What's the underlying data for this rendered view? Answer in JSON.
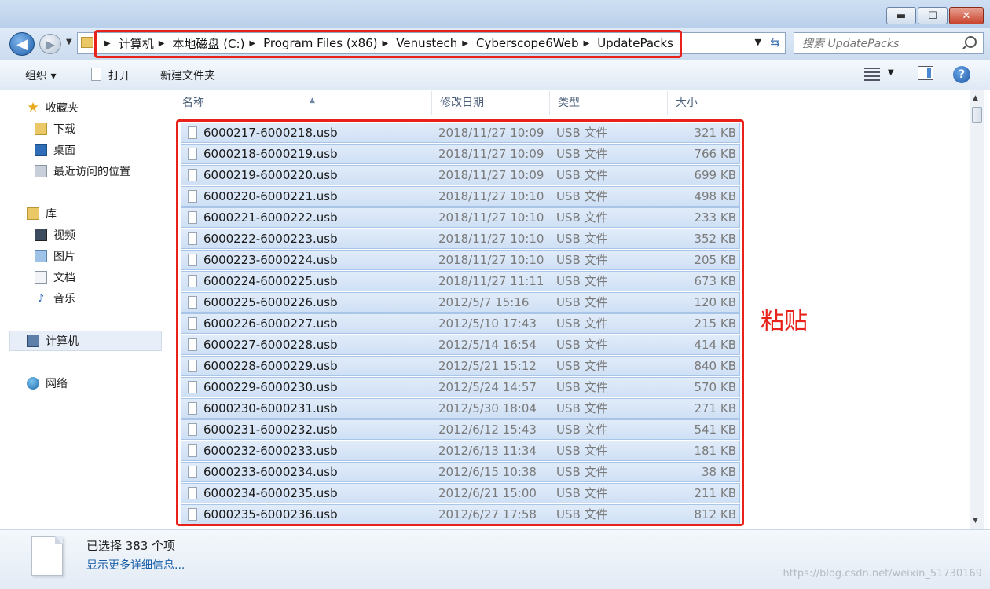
{
  "address": {
    "crumbs": [
      "计算机",
      "本地磁盘 (C:)",
      "Program Files (x86)",
      "Venustech",
      "Cyberscope6Web",
      "UpdatePacks"
    ]
  },
  "search": {
    "placeholder": "搜索 UpdatePacks"
  },
  "toolbar": {
    "organize": "组织 ▾",
    "open": "打开",
    "new_folder": "新建文件夹"
  },
  "sidebar": {
    "favorites": {
      "label": "收藏夹",
      "items": [
        "下载",
        "桌面",
        "最近访问的位置"
      ]
    },
    "libraries": {
      "label": "库",
      "items": [
        "视频",
        "图片",
        "文档",
        "音乐"
      ]
    },
    "computer": "计算机",
    "network": "网络"
  },
  "columns": {
    "name": "名称",
    "date": "修改日期",
    "type": "类型",
    "size": "大小"
  },
  "files": [
    {
      "name": "6000217-6000218.usb",
      "date": "2018/11/27 10:09",
      "type": "USB 文件",
      "size": "321 KB"
    },
    {
      "name": "6000218-6000219.usb",
      "date": "2018/11/27 10:09",
      "type": "USB 文件",
      "size": "766 KB"
    },
    {
      "name": "6000219-6000220.usb",
      "date": "2018/11/27 10:09",
      "type": "USB 文件",
      "size": "699 KB"
    },
    {
      "name": "6000220-6000221.usb",
      "date": "2018/11/27 10:10",
      "type": "USB 文件",
      "size": "498 KB"
    },
    {
      "name": "6000221-6000222.usb",
      "date": "2018/11/27 10:10",
      "type": "USB 文件",
      "size": "233 KB"
    },
    {
      "name": "6000222-6000223.usb",
      "date": "2018/11/27 10:10",
      "type": "USB 文件",
      "size": "352 KB"
    },
    {
      "name": "6000223-6000224.usb",
      "date": "2018/11/27 10:10",
      "type": "USB 文件",
      "size": "205 KB"
    },
    {
      "name": "6000224-6000225.usb",
      "date": "2018/11/27 11:11",
      "type": "USB 文件",
      "size": "673 KB"
    },
    {
      "name": "6000225-6000226.usb",
      "date": "2012/5/7 15:16",
      "type": "USB 文件",
      "size": "120 KB"
    },
    {
      "name": "6000226-6000227.usb",
      "date": "2012/5/10 17:43",
      "type": "USB 文件",
      "size": "215 KB"
    },
    {
      "name": "6000227-6000228.usb",
      "date": "2012/5/14 16:54",
      "type": "USB 文件",
      "size": "414 KB"
    },
    {
      "name": "6000228-6000229.usb",
      "date": "2012/5/21 15:12",
      "type": "USB 文件",
      "size": "840 KB"
    },
    {
      "name": "6000229-6000230.usb",
      "date": "2012/5/24 14:57",
      "type": "USB 文件",
      "size": "570 KB"
    },
    {
      "name": "6000230-6000231.usb",
      "date": "2012/5/30 18:04",
      "type": "USB 文件",
      "size": "271 KB"
    },
    {
      "name": "6000231-6000232.usb",
      "date": "2012/6/12 15:43",
      "type": "USB 文件",
      "size": "541 KB"
    },
    {
      "name": "6000232-6000233.usb",
      "date": "2012/6/13 11:34",
      "type": "USB 文件",
      "size": "181 KB"
    },
    {
      "name": "6000233-6000234.usb",
      "date": "2012/6/15 10:38",
      "type": "USB 文件",
      "size": "38 KB"
    },
    {
      "name": "6000234-6000235.usb",
      "date": "2012/6/21 15:00",
      "type": "USB 文件",
      "size": "211 KB"
    },
    {
      "name": "6000235-6000236.usb",
      "date": "2012/6/27 17:58",
      "type": "USB 文件",
      "size": "812 KB"
    }
  ],
  "annotation": {
    "text": "粘贴",
    "color": "#e8221b"
  },
  "details": {
    "selected": "已选择 383 个项",
    "more_link": "显示更多详细信息..."
  },
  "watermark": "https://blog.csdn.net/weixin_51730169",
  "colors": {
    "selection": "#cfe0f5",
    "accent": "#1a5ea8"
  }
}
